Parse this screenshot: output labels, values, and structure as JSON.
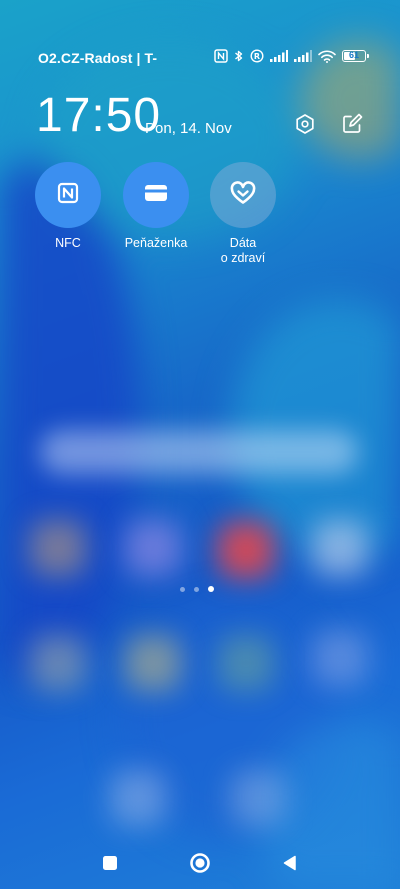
{
  "status_bar": {
    "carrier": "O2.CZ-Radost | T-",
    "battery_level": "61",
    "icons": [
      "nfc-icon",
      "bluetooth-icon",
      "roaming-r-icon",
      "signal-icon",
      "signal-icon",
      "wifi-icon",
      "battery-icon"
    ]
  },
  "header": {
    "time": "17:50",
    "date": "Pon, 14. Nov",
    "settings_icon": "settings-hex-icon",
    "edit_icon": "edit-icon"
  },
  "toggles": [
    {
      "label": "NFC",
      "icon": "nfc-icon",
      "active": true
    },
    {
      "label": "Peňaženka",
      "icon": "wallet-icon",
      "active": true
    },
    {
      "label_line1": "Dáta",
      "label_line2": "o zdraví",
      "icon": "health-heart-icon",
      "active": false
    }
  ],
  "page_indicator": {
    "count": 3,
    "active_index": 2
  },
  "navigation": {
    "recents_icon": "square-icon",
    "home_icon": "circle-icon",
    "back_icon": "triangle-back-icon"
  },
  "colors": {
    "toggle_active": "#3b8ff0",
    "toggle_inactive": "#78aad7",
    "text": "#ffffff"
  }
}
